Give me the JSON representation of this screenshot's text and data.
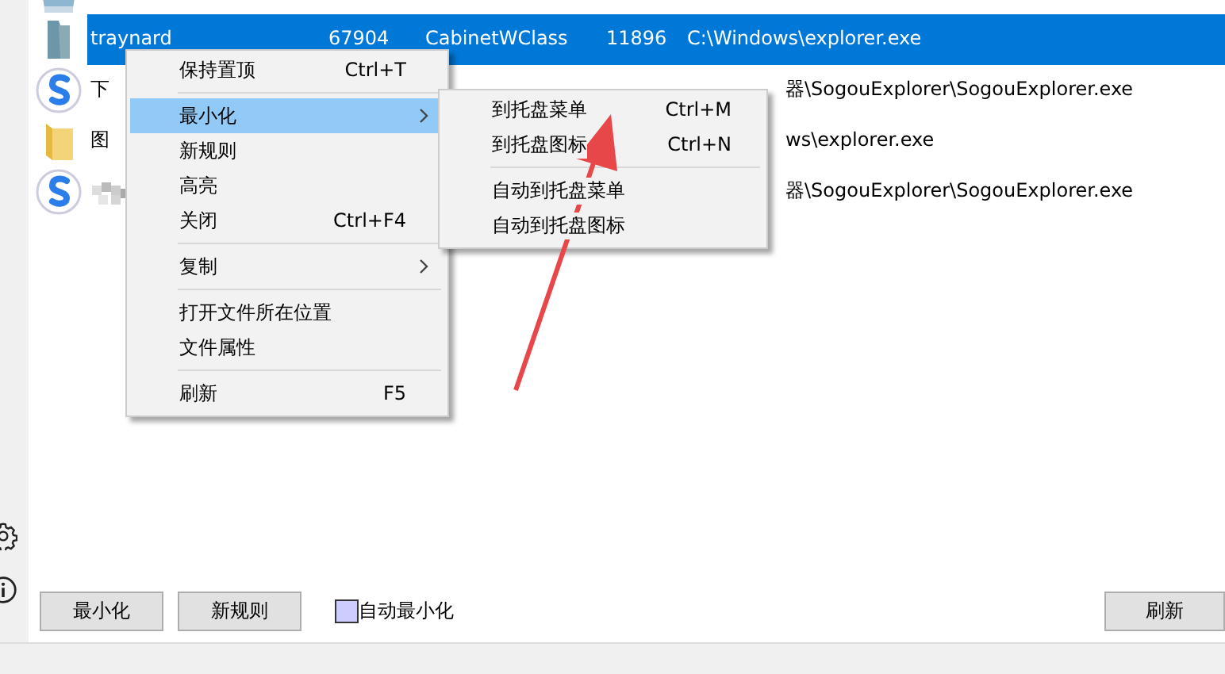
{
  "rows": [
    {
      "kind": "app",
      "selected": false,
      "cells": []
    },
    {
      "kind": "cabinet",
      "selected": true,
      "cells": [
        "traynard",
        "67904",
        "CabinetWClass",
        "11896",
        "C:\\Windows\\explorer.exe"
      ]
    },
    {
      "kind": "sogou",
      "selected": false,
      "cells": [
        "下",
        "",
        "",
        "",
        "器\\SogouExplorer\\SogouExplorer.exe"
      ]
    },
    {
      "kind": "folder",
      "selected": false,
      "cells": [
        "图",
        "",
        "",
        "",
        "ws\\explorer.exe"
      ]
    },
    {
      "kind": "sogou",
      "selected": false,
      "pixelated": true,
      "cells": [
        "",
        "",
        "",
        "",
        "器\\SogouExplorer\\SogouExplorer.exe"
      ]
    }
  ],
  "context_menu": [
    {
      "kind": "item",
      "label": "保持置顶",
      "shortcut": "Ctrl+T",
      "selected": false,
      "submenu": false
    },
    {
      "kind": "separator"
    },
    {
      "kind": "item",
      "label": "最小化",
      "selected": true,
      "submenu": true
    },
    {
      "kind": "item",
      "label": "新规则",
      "selected": false,
      "submenu": false
    },
    {
      "kind": "item",
      "label": "高亮",
      "selected": false,
      "submenu": false
    },
    {
      "kind": "item",
      "label": "关闭",
      "shortcut": "Ctrl+F4",
      "selected": false,
      "submenu": false
    },
    {
      "kind": "separator"
    },
    {
      "kind": "item",
      "label": "复制",
      "selected": false,
      "submenu": true
    },
    {
      "kind": "separator"
    },
    {
      "kind": "item",
      "label": "打开文件所在位置",
      "selected": false,
      "submenu": false
    },
    {
      "kind": "item",
      "label": "文件属性",
      "selected": false,
      "submenu": false
    },
    {
      "kind": "separator"
    },
    {
      "kind": "item",
      "label": "刷新",
      "shortcut": "F5",
      "selected": false,
      "submenu": false
    }
  ],
  "submenu": [
    {
      "kind": "item",
      "label": "到托盘菜单",
      "shortcut": "Ctrl+M",
      "selected": false
    },
    {
      "kind": "item",
      "label": "到托盘图标",
      "shortcut": "Ctrl+N",
      "selected": false
    },
    {
      "kind": "separator"
    },
    {
      "kind": "item",
      "label": "自动到托盘菜单",
      "selected": false
    },
    {
      "kind": "item",
      "label": "自动到托盘图标",
      "selected": false
    }
  ],
  "buttons": [
    "最小化",
    "新规则"
  ],
  "auto_minimize": {
    "label": "自动最小化",
    "checked": false
  },
  "refresh_button": "刷新"
}
